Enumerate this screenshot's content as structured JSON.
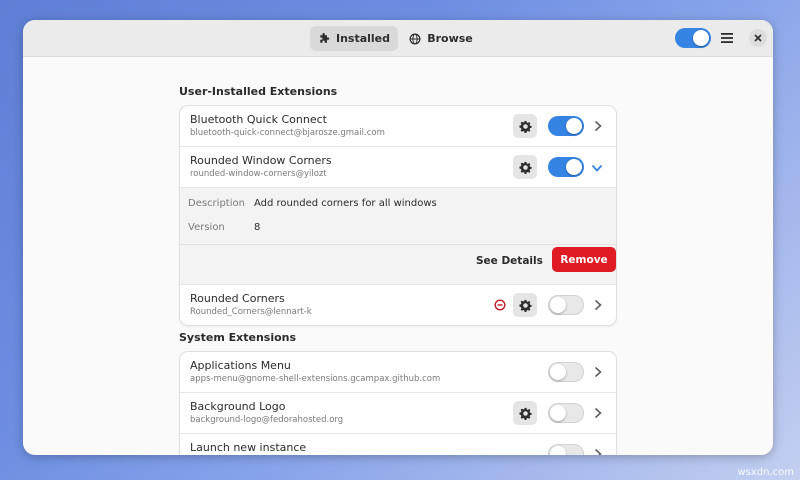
{
  "header": {
    "tabs": [
      {
        "label": "Installed",
        "icon": "puzzle-icon",
        "active": true
      },
      {
        "label": "Browse",
        "icon": "globe-icon",
        "active": false
      }
    ],
    "global_toggle": true
  },
  "user_section": {
    "title": "User-Installed Extensions",
    "items": [
      {
        "name": "Bluetooth Quick Connect",
        "uuid": "bluetooth-quick-connect@bjarosze.gmail.com",
        "enabled": true,
        "has_settings": true
      },
      {
        "name": "Rounded Window Corners",
        "uuid": "rounded-window-corners@yilozt",
        "enabled": true,
        "has_settings": true,
        "expanded": true,
        "details": {
          "description_label": "Description",
          "description": "Add rounded corners for all windows",
          "version_label": "Version",
          "version": "8",
          "see_details": "See Details",
          "remove": "Remove"
        }
      },
      {
        "name": "Rounded Corners",
        "uuid": "Rounded_Corners@lennart-k",
        "enabled": false,
        "has_settings": true,
        "error": true
      }
    ]
  },
  "system_section": {
    "title": "System Extensions",
    "items": [
      {
        "name": "Applications Menu",
        "uuid": "apps-menu@gnome-shell-extensions.gcampax.github.com",
        "enabled": false,
        "has_settings": false
      },
      {
        "name": "Background Logo",
        "uuid": "background-logo@fedorahosted.org",
        "enabled": false,
        "has_settings": true
      },
      {
        "name": "Launch new instance",
        "uuid": "",
        "enabled": false,
        "has_settings": false
      }
    ]
  },
  "colors": {
    "accent": "#3584e4",
    "destructive": "#e01b24",
    "error_icon": "#c01c28"
  },
  "watermark": "wsxdn.com"
}
